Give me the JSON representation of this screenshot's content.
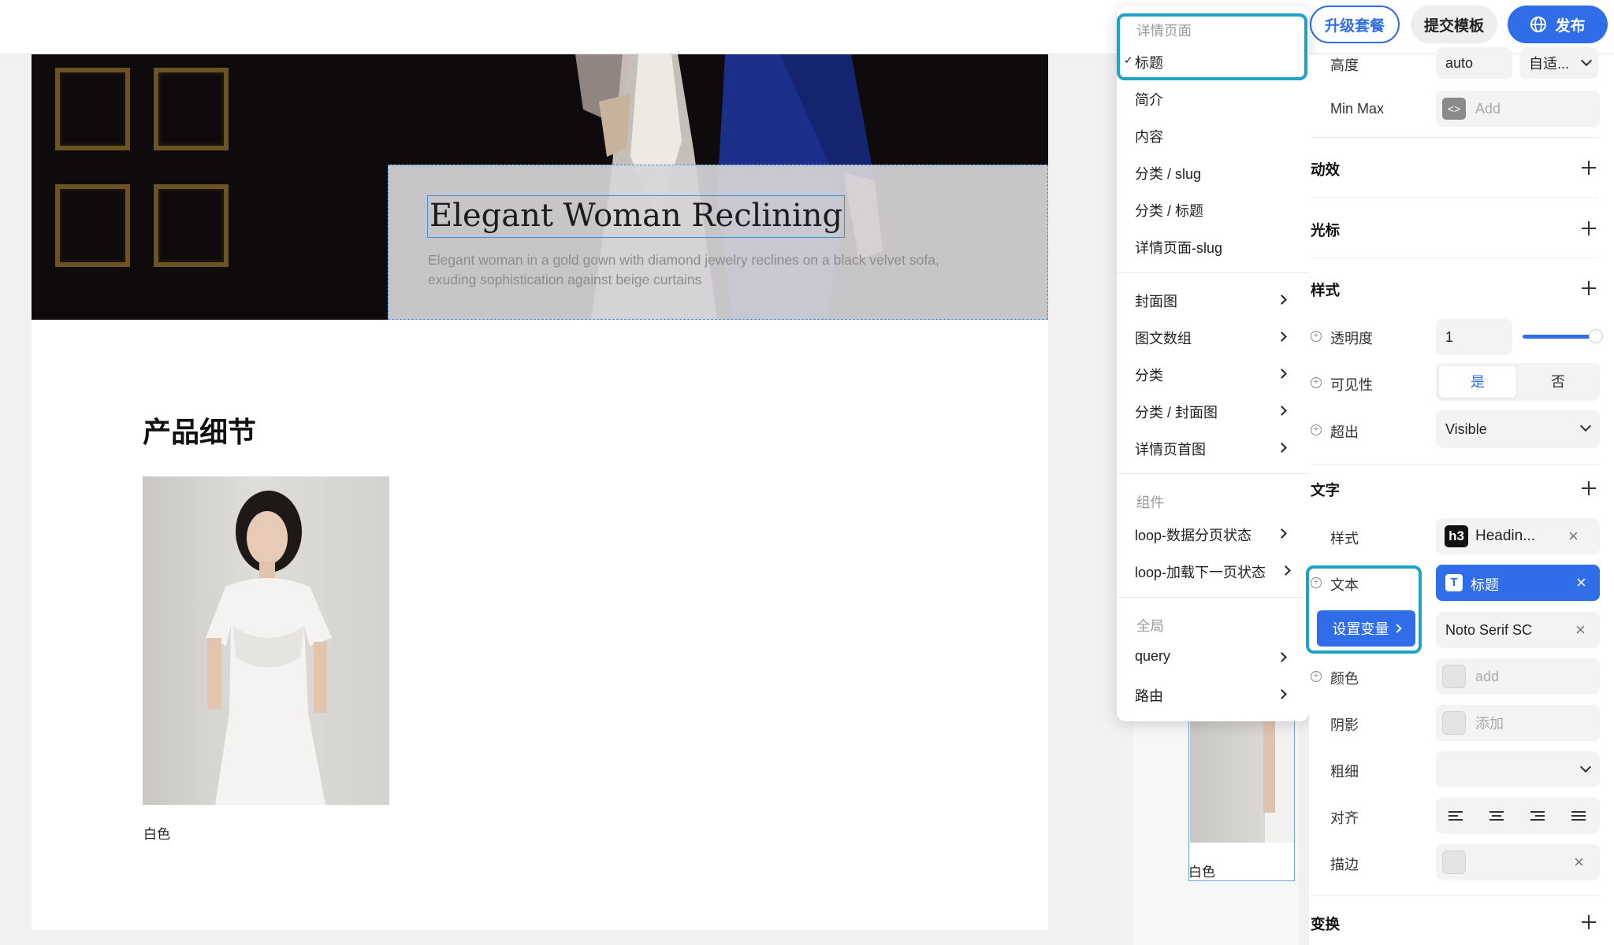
{
  "toolbar": {
    "upgrade_label": "升级套餐",
    "submit_template_label": "提交模板",
    "publish_label": "发布"
  },
  "canvas": {
    "hero": {
      "title": "Elegant Woman Reclining",
      "description": "Elegant woman in a gold gown with diamond jewelry reclines on a black velvet sofa, exuding sophistication against beige curtains"
    },
    "section_title": "产品细节",
    "product_caption": "白色",
    "side_caption": "白色"
  },
  "menu": {
    "group_detail_header": "详情页面",
    "checkmark": "✓",
    "detail_items": [
      "标题",
      "简介",
      "内容",
      "分类 / slug",
      "分类 / 标题",
      "详情页面-slug"
    ],
    "submenu_items": [
      "封面图",
      "图文数组",
      "分类",
      "分类 / 封面图",
      "详情页首图"
    ],
    "components_header": "组件",
    "component_items": [
      "loop-数据分页状态",
      "loop-加载下一页状态"
    ],
    "global_header": "全局",
    "global_items": [
      "query",
      "路由"
    ]
  },
  "props": {
    "height_label": "高度",
    "height_value": "auto",
    "height_mode": "自适...",
    "minmax_label": "Min Max",
    "minmax_placeholder": "Add",
    "sections": {
      "animation": "动效",
      "cursor": "光标",
      "style": "样式",
      "text": "文字",
      "transform": "变换"
    },
    "opacity_label": "透明度",
    "opacity_value": "1",
    "opacity_level": 1.0,
    "visibility_label": "可见性",
    "visibility_yes": "是",
    "visibility_no": "否",
    "overflow_label": "超出",
    "overflow_value": "Visible",
    "text_style_label": "样式",
    "text_style_badge": "h3",
    "text_style_value": "Headin...",
    "text_label": "文本",
    "text_binding_icon": "T",
    "text_binding_value": "标题",
    "set_variable_label": "设置变量",
    "font_value": "Noto Serif SC",
    "color_label": "颜色",
    "color_placeholder": "add",
    "shadow_label": "阴影",
    "shadow_placeholder": "添加",
    "weight_label": "粗细",
    "align_label": "对齐",
    "stroke_label": "描边",
    "accent_color": "#2f6ee8",
    "highlight_color": "#1fa3c4"
  }
}
